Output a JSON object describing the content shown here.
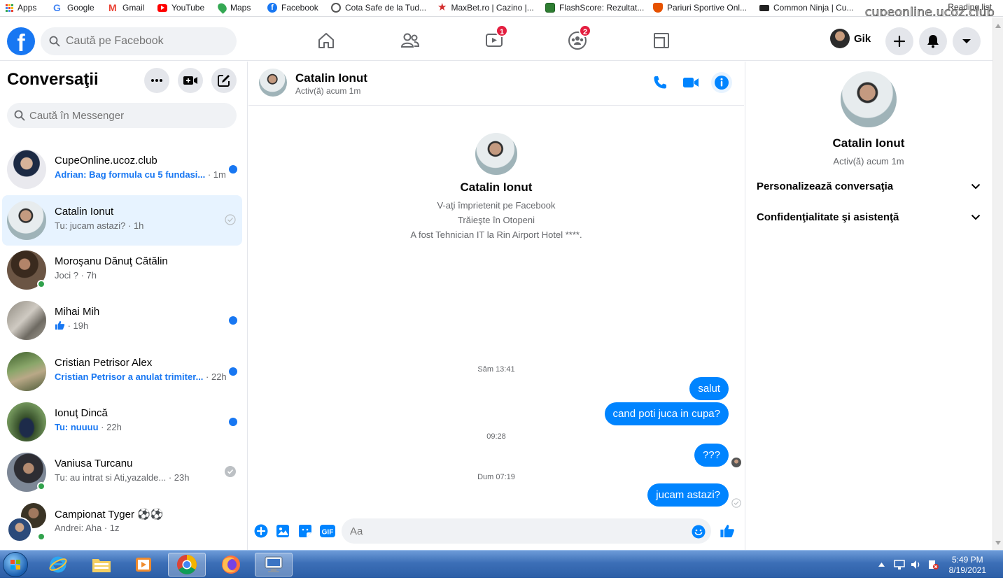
{
  "bookmarks": {
    "items": [
      {
        "label": "Apps",
        "color": "#ea4335"
      },
      {
        "label": "Google",
        "color": "#4285f4"
      },
      {
        "label": "Gmail",
        "color": "#ea4335"
      },
      {
        "label": "YouTube",
        "color": "#ff0000"
      },
      {
        "label": "Maps",
        "color": "#34a853"
      },
      {
        "label": "Facebook",
        "color": "#1877f2"
      },
      {
        "label": "Cota Safe de la Tud...",
        "color": "#555555"
      },
      {
        "label": "MaxBet.ro | Cazino |...",
        "color": "#d32f2f"
      },
      {
        "label": "FlashScore: Rezultat...",
        "color": "#2e7d32"
      },
      {
        "label": "Pariuri Sportive Onl...",
        "color": "#e65100"
      },
      {
        "label": "Common Ninja | Cu...",
        "color": "#222222"
      }
    ],
    "reading_list": "Reading list",
    "watermark": "cupeonline.ucoz.club"
  },
  "nav": {
    "search_placeholder": "Caută pe Facebook",
    "watch_badge": "1",
    "groups_badge": "2",
    "profile_name": "Gik"
  },
  "sidebar": {
    "title": "Conversaţii",
    "search_placeholder": "Caută în Messenger",
    "conversations": [
      {
        "name": "CupeOnline.ucoz.club",
        "preview": "Adrian: Bag formula cu 5 fundasi...",
        "time": " · 1m"
      },
      {
        "name": "Catalin Ionut",
        "preview": "Tu: jucam astazi? ",
        "time": "· 1h"
      },
      {
        "name": "Moroşanu Dănuţ Cătălin",
        "preview": "Joci ? ",
        "time": "· 7h"
      },
      {
        "name": "Mihai Mih",
        "preview": "",
        "time": " · 19h"
      },
      {
        "name": "Cristian Petrisor Alex",
        "preview": "Cristian Petrisor a anulat trimiter...",
        "time": " · 22h"
      },
      {
        "name": "Ionuţ Dincă",
        "preview": "Tu: nuuuu",
        "time": " · 22h"
      },
      {
        "name": "Vaniusa Turcanu",
        "preview": "Tu: au intrat si Ati,yazalde... ",
        "time": "· 23h"
      },
      {
        "name": "Campionat Tyger ⚽⚽",
        "preview": "Andrei: Aha ",
        "time": "· 1z"
      }
    ]
  },
  "chat": {
    "contact_name": "Catalin Ionut",
    "contact_status": "Activ(ă) acum 1m",
    "profile_lines": [
      "V-aţi împrietenit pe Facebook",
      "Trăieşte în Otopeni",
      "A fost Tehnician IT la Rin Airport Hotel ****."
    ],
    "timestamps": [
      "Sâm 13:41",
      "09:28",
      "Dum 07:19"
    ],
    "messages": [
      "salut",
      "cand poti juca in cupa?",
      "???",
      "jucam astazi?"
    ],
    "composer_placeholder": "Aa"
  },
  "info": {
    "name": "Catalin Ionut",
    "status": "Activ(ă) acum 1m",
    "rows": [
      "Personalizează conversaţia",
      "Confidenţialitate şi asistenţă"
    ]
  },
  "taskbar": {
    "time": "5:49 PM",
    "date": "8/19/2021"
  },
  "colors": {
    "accent": "#1877f2",
    "bubble": "#0084ff",
    "selected_row": "#e7f3ff",
    "online": "#31a24c"
  }
}
